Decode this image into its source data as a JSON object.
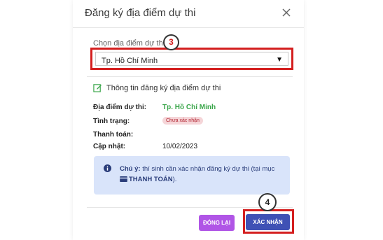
{
  "dialog": {
    "title": "Đăng ký địa điểm dự thi"
  },
  "select": {
    "label": "Chọn địa điểm dự thi",
    "value": "Tp. Hồ Chí Minh"
  },
  "callouts": {
    "step_select": "3",
    "step_confirm": "4"
  },
  "section": {
    "title": "Thông tin đăng ký địa điểm dự thi"
  },
  "info": {
    "location_label": "Địa điểm dự thi:",
    "location_value": "Tp. Hồ Chí Minh",
    "status_label": "Tình trạng:",
    "status_value": "Chưa xác nhận",
    "payment_label": "Thanh toán:",
    "updated_label": "Cập nhật:",
    "updated_value": "10/02/2023"
  },
  "notice": {
    "prefix": "Chú ý:",
    "body": " thí sinh cần xác nhận đăng ký dự thi (tại mục ",
    "link": "THANH TOÁN",
    "suffix": ")."
  },
  "buttons": {
    "close_label": "ĐÓNG LẠI",
    "confirm_label": "XÁC NHẬN"
  },
  "colors": {
    "highlight_red": "#d41f1f",
    "confirm_blue": "#3f51b5",
    "close_purple": "#b055e6",
    "success_green": "#3aa64a",
    "notice_bg": "#d9e4fa"
  }
}
